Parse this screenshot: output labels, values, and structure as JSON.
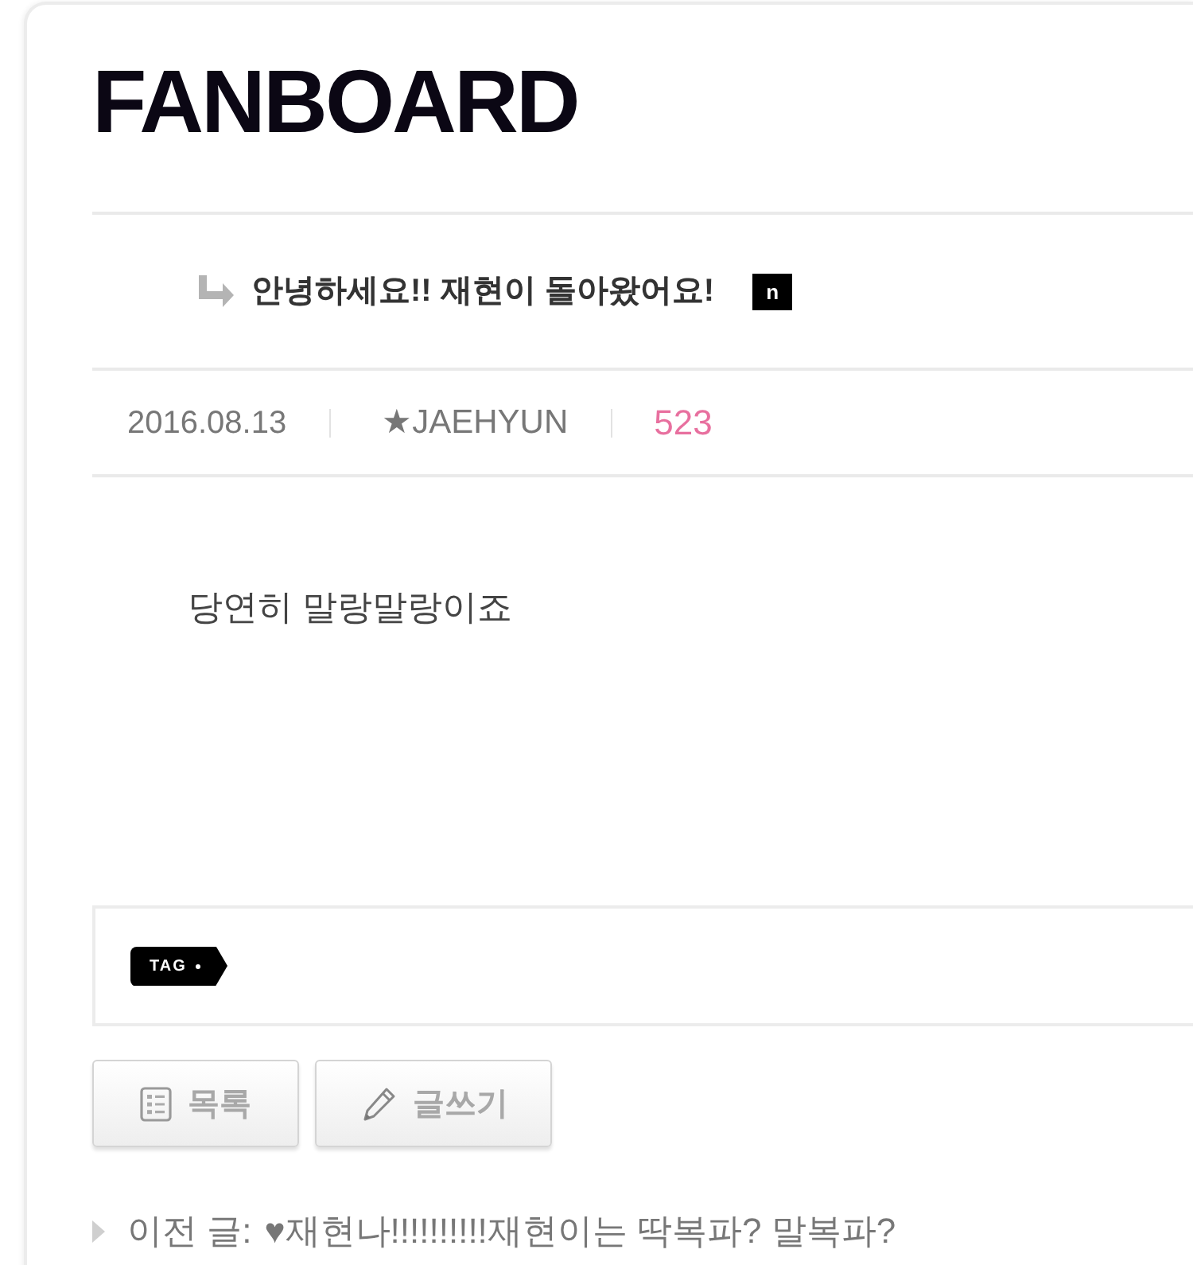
{
  "logo": {
    "text": "FANBOARD"
  },
  "post": {
    "title": "안녕하세요!! 재현이 돌아왔어요!",
    "new_badge": "n",
    "date": "2016.08.13",
    "author": "★JAEHYUN",
    "views": "523",
    "body": "당연히 말랑말랑이죠"
  },
  "tags": {
    "label": "TAG"
  },
  "buttons": [
    {
      "kind": "list",
      "label": "목록"
    },
    {
      "kind": "write",
      "label": "글쓰기"
    }
  ],
  "previous_post": {
    "label": "이전 글:",
    "title": "♥재현나!!!!!!!!!!재현이는 딱복파? 말복파?"
  }
}
